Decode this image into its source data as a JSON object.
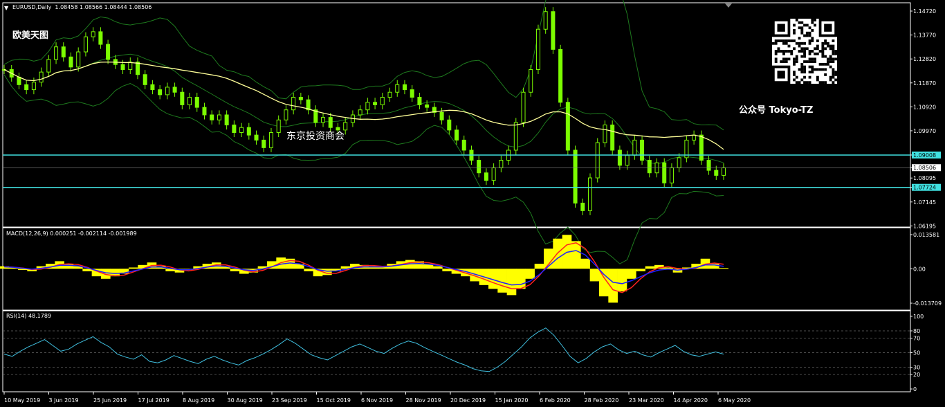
{
  "window": {
    "symbol_header": "EURUSD,Daily  1.08458 1.08566 1.08444 1.08506"
  },
  "overlays": {
    "top_left_label": "欧美天图",
    "watermark_center": "东京投资商会",
    "wechat_label": "公众号 Tokyo-TZ"
  },
  "colors": {
    "background": "#000000",
    "axis": "#ffffff",
    "candle": "#7cfc00",
    "bollinger": "#1e7a1e",
    "moving_average": "#ffff99",
    "support_resistance": "#40e0e0",
    "macd_histogram": "#ffff00",
    "macd_line": "#ff2020",
    "signal_line": "#2020ff",
    "rsi_line": "#40c0e0"
  },
  "chart_data": [
    {
      "type": "candlestick",
      "pane": "price",
      "symbol": "EURUSD",
      "timeframe": "Daily",
      "ohlc_last": {
        "open": 1.08458,
        "high": 1.08566,
        "low": 1.08444,
        "close": 1.08506
      },
      "y_ticks": [
        "1.14720",
        "1.13770",
        "1.12820",
        "1.11870",
        "1.10920",
        "1.09970",
        "1.09008",
        "1.08506",
        "1.08095",
        "1.07724",
        "1.07145",
        "1.06195"
      ],
      "y_tick_values": [
        1.1472,
        1.1377,
        1.1282,
        1.1187,
        1.1092,
        1.0997,
        1.09008,
        1.08506,
        1.08095,
        1.07724,
        1.07145,
        1.06195
      ],
      "ylim": [
        1.0615,
        1.1505
      ],
      "highlighted_ticks": [
        "1.09008",
        "1.07724"
      ],
      "horizontal_levels": [
        1.09008,
        1.07724
      ],
      "current_price": 1.08506,
      "x_labels": [
        "10 May 2019",
        "3 Jun 2019",
        "25 Jun 2019",
        "17 Jul 2019",
        "8 Aug 2019",
        "30 Aug 2019",
        "23 Sep 2019",
        "15 Oct 2019",
        "6 Nov 2019",
        "28 Nov 2019",
        "20 Dec 2019",
        "15 Jan 2020",
        "6 Feb 2020",
        "28 Feb 2020",
        "23 Mar 2020",
        "14 Apr 2020",
        "6 May 2020"
      ],
      "close_series": {
        "start": "10 May 2019",
        "end": "6 May 2020",
        "values": [
          1.124,
          1.121,
          1.118,
          1.116,
          1.119,
          1.123,
          1.128,
          1.133,
          1.129,
          1.125,
          1.131,
          1.137,
          1.139,
          1.134,
          1.128,
          1.126,
          1.124,
          1.127,
          1.122,
          1.118,
          1.116,
          1.114,
          1.117,
          1.115,
          1.11,
          1.113,
          1.109,
          1.106,
          1.104,
          1.106,
          1.102,
          1.099,
          1.101,
          1.098,
          1.096,
          1.093,
          1.099,
          1.104,
          1.108,
          1.113,
          1.112,
          1.108,
          1.103,
          1.105,
          1.101,
          1.1,
          1.103,
          1.106,
          1.108,
          1.111,
          1.11,
          1.113,
          1.115,
          1.118,
          1.116,
          1.113,
          1.11,
          1.109,
          1.107,
          1.104,
          1.1,
          1.096,
          1.092,
          1.088,
          1.083,
          1.08,
          1.085,
          1.088,
          1.092,
          1.103,
          1.115,
          1.124,
          1.14,
          1.147,
          1.132,
          1.111,
          1.092,
          1.071,
          1.068,
          1.081,
          1.095,
          1.102,
          1.092,
          1.086,
          1.09,
          1.096,
          1.088,
          1.083,
          1.087,
          1.079,
          1.085,
          1.089,
          1.096,
          1.098,
          1.088,
          1.084,
          1.082,
          1.085
        ]
      },
      "indicators": [
        "Bollinger Bands",
        "Moving Average"
      ]
    },
    {
      "type": "bar+line",
      "pane": "macd",
      "title": "MACD(12,26,9) 0.000251 -0.002114 -0.001989",
      "params": [
        12,
        26,
        9
      ],
      "values": [
        0.000251,
        -0.002114,
        -0.001989
      ],
      "y_ticks": [
        "0.013581",
        "0.00",
        "-0.013709"
      ],
      "ylim": [
        -0.013709,
        0.013581
      ],
      "histogram": [
        0.001,
        0.0005,
        -0.0005,
        -0.001,
        0.001,
        0.002,
        0.003,
        0.002,
        0.001,
        -0.001,
        -0.003,
        -0.004,
        -0.003,
        -0.002,
        0.0005,
        0.0015,
        0.0025,
        0.001,
        -0.001,
        -0.0015,
        -0.0005,
        0.001,
        0.002,
        0.0025,
        0.001,
        -0.001,
        -0.002,
        -0.0015,
        0.001,
        0.003,
        0.0045,
        0.004,
        0.002,
        -0.001,
        -0.003,
        -0.0025,
        -0.001,
        0.001,
        0.002,
        0.0015,
        0.001,
        0.001,
        0.002,
        0.003,
        0.0035,
        0.003,
        0.002,
        0.001,
        -0.001,
        -0.002,
        -0.003,
        -0.005,
        -0.0065,
        -0.008,
        -0.0095,
        -0.0105,
        -0.008,
        -0.004,
        0.002,
        0.008,
        0.012,
        0.0135,
        0.011,
        0.004,
        -0.005,
        -0.011,
        -0.0135,
        -0.009,
        -0.004,
        -0.001,
        0.001,
        0.0015,
        0.0005,
        -0.0015,
        0.0005,
        0.002,
        0.004,
        0.002,
        0.0003
      ]
    },
    {
      "type": "line",
      "pane": "rsi",
      "title": "RSI(14) 48.1789",
      "period": 14,
      "value": 48.1789,
      "y_ticks": [
        "100",
        "80",
        "70",
        "50",
        "30",
        "20",
        "0"
      ],
      "ylim": [
        0,
        100
      ],
      "levels": [
        80,
        70,
        50,
        30,
        20
      ],
      "values": [
        48,
        45,
        52,
        58,
        63,
        68,
        60,
        52,
        55,
        62,
        67,
        72,
        64,
        58,
        48,
        44,
        41,
        47,
        38,
        36,
        40,
        46,
        42,
        38,
        35,
        41,
        45,
        40,
        36,
        33,
        39,
        43,
        48,
        54,
        61,
        69,
        63,
        55,
        47,
        43,
        40,
        46,
        52,
        58,
        62,
        57,
        52,
        49,
        56,
        62,
        66,
        63,
        57,
        52,
        47,
        42,
        37,
        33,
        28,
        25,
        24,
        30,
        38,
        48,
        58,
        70,
        78,
        84,
        74,
        60,
        45,
        36,
        42,
        51,
        58,
        62,
        54,
        49,
        52,
        47,
        44,
        50,
        55,
        60,
        52,
        47,
        45,
        48,
        51,
        48
      ]
    }
  ]
}
